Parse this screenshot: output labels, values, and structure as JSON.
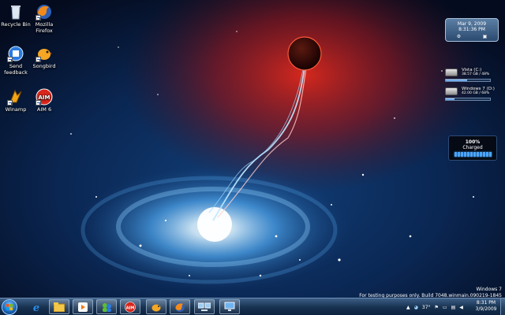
{
  "desktop": {
    "icons": [
      {
        "label": "Recycle Bin",
        "icon": "recycle-bin-icon"
      },
      {
        "label": "Mozilla Firefox",
        "icon": "firefox-icon"
      },
      {
        "label": "Send feedback",
        "icon": "send-feedback-icon"
      },
      {
        "label": "Songbird",
        "icon": "songbird-icon"
      },
      {
        "label": "Winamp",
        "icon": "winamp-icon"
      },
      {
        "label": "AIM 6",
        "icon": "aim-icon"
      }
    ]
  },
  "gadgets": {
    "clock": {
      "date": "Mar 9, 2009",
      "time": "8:31:36 PM"
    },
    "drives": [
      {
        "name": "Vista (C:)",
        "stats": "38.57 GB / 48%",
        "used_fraction": 0.48
      },
      {
        "name": "Windows 7 (D:)",
        "stats": "42.00 GB / 68%",
        "used_fraction": 0.2
      }
    ],
    "battery": {
      "percent": "100%",
      "status": "Charged",
      "cells": 12
    }
  },
  "watermark": {
    "line1": "Windows 7",
    "line2": "For testing purposes only. Build 7048.winmain.090219-1845"
  },
  "taskbar": {
    "pinned": [
      "ie-icon",
      "explorer-icon",
      "media-player-icon",
      "messenger-icon",
      "aim-icon",
      "songbird-icon",
      "firefox-icon",
      "network-icon",
      "computer-icon"
    ],
    "tray": {
      "temperature": "37°"
    },
    "clock": {
      "time": "8:31 PM",
      "date": "3/9/2009"
    }
  },
  "colors": {
    "accent": "#3a86e0",
    "taskbar": "#16314f",
    "nebula_red": "#c01818",
    "galaxy_blue": "#5fb8ff"
  }
}
